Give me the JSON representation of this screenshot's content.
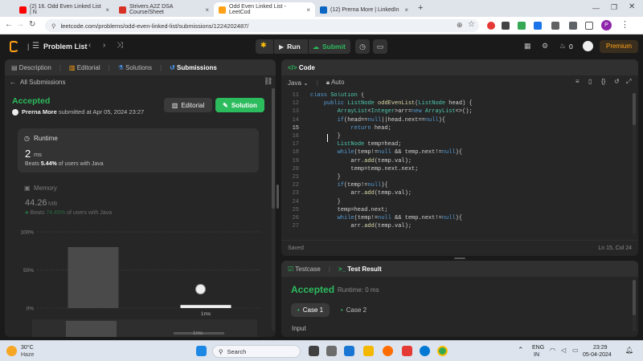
{
  "browser": {
    "tabs": [
      {
        "label": "(2) 16. Odd Even Linked List | N",
        "color": "#ff0000"
      },
      {
        "label": "Strivers A2Z DSA Course/Sheet",
        "color": "#d93025"
      },
      {
        "label": "Odd Even Linked List - LeetCod",
        "color": "#ffa116"
      },
      {
        "label": "(12) Prerna More | LinkedIn",
        "color": "#0a66c2"
      }
    ],
    "new_tab": "+",
    "url": "leetcode.com/problems/odd-even-linked-list/submissions/1224202487/"
  },
  "topbar": {
    "problem_list": "Problem List",
    "run": "Run",
    "submit": "Submit",
    "streak": "0",
    "premium": "Premium"
  },
  "left": {
    "tabs": [
      "Description",
      "Editorial",
      "Solutions",
      "Submissions"
    ],
    "back_label": "All Submissions",
    "status": "Accepted",
    "user": "Prerna More",
    "submitted": "submitted at Apr 05, 2024 23:27",
    "editorial_btn": "Editorial",
    "solution_btn": "Solution",
    "runtime": {
      "title": "Runtime",
      "value": "2",
      "unit": "ms",
      "beats_prefix": "Beats",
      "beats_pct": "5.44%",
      "beats_suffix": "of users with Java"
    },
    "memory": {
      "title": "Memory",
      "value": "44.26",
      "unit": "MB",
      "beats_prefix": "Beats",
      "beats_pct": "74.45%",
      "beats_suffix": "of users with Java"
    }
  },
  "chart_data": {
    "type": "bar",
    "title": "",
    "xlabel": "",
    "ylabel": "",
    "yticks": [
      "100%",
      "50%",
      "0%"
    ],
    "ylim": [
      0,
      100
    ],
    "categories": [
      "",
      "1ms"
    ],
    "values": [
      80,
      4
    ],
    "highlight_label": "1ms"
  },
  "code": {
    "title": "Code",
    "language": "Java",
    "mode": "Auto",
    "lines": [
      {
        "n": "11",
        "t": "class Solution {"
      },
      {
        "n": "12",
        "t": "    public ListNode oddEvenList(ListNode head) {"
      },
      {
        "n": "13",
        "t": "        ArrayList<Integer>arr=new ArrayList<>();"
      },
      {
        "n": "14",
        "t": "        if(head==null||head.next==null){"
      },
      {
        "n": "15",
        "t": "            return head;"
      },
      {
        "n": "16",
        "t": "        }"
      },
      {
        "n": "17",
        "t": "        ListNode temp=head;"
      },
      {
        "n": "18",
        "t": "        while(temp!=null && temp.next!=null){"
      },
      {
        "n": "19",
        "t": "            arr.add(temp.val);"
      },
      {
        "n": "20",
        "t": "            temp=temp.next.next;"
      },
      {
        "n": "21",
        "t": "        }"
      },
      {
        "n": "22",
        "t": "        if(temp!=null){"
      },
      {
        "n": "23",
        "t": "            arr.add(temp.val);"
      },
      {
        "n": "24",
        "t": "        }"
      },
      {
        "n": "25",
        "t": "        temp=head.next;"
      },
      {
        "n": "26",
        "t": "        while(temp!=null && temp.next!=null){"
      },
      {
        "n": "27",
        "t": "            arr.add(temp.val);"
      }
    ],
    "saved": "Saved",
    "cursor": "Ln 15, Col 24"
  },
  "testpanel": {
    "tabs": [
      "Testcase",
      "Test Result"
    ],
    "status": "Accepted",
    "runtime": "Runtime: 0 ms",
    "cases": [
      "Case 1",
      "Case 2"
    ],
    "input_label": "Input"
  },
  "taskbar": {
    "temp": "30°C",
    "weather": "Haze",
    "search": "Search",
    "lang1": "ENG",
    "lang2": "IN",
    "time": "23:29",
    "date": "05-04-2024"
  }
}
